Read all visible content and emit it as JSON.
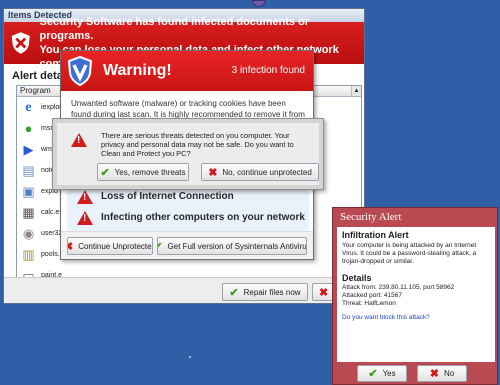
{
  "main_window": {
    "title": "Items Detected",
    "banner_line1": "Security Software has found infected documents or programs.",
    "banner_line2": "You can lose your personal data and infect other network computers.",
    "alert_details_label": "Alert details",
    "list_header": "Program",
    "programs": [
      {
        "label": "iexplor",
        "icon": "internet-explorer-icon"
      },
      {
        "label": "msmn.",
        "icon": "messenger-icon"
      },
      {
        "label": "wmp",
        "icon": "media-player-icon"
      },
      {
        "label": "note",
        "icon": "notepad-icon"
      },
      {
        "label": "explo",
        "icon": "explorer-icon"
      },
      {
        "label": "calc.ex",
        "icon": "calculator-icon"
      },
      {
        "label": "user32",
        "icon": "disc-icon"
      },
      {
        "label": "pools.e",
        "icon": "calendar-icon"
      },
      {
        "label": "paint.e",
        "icon": "printer-icon"
      }
    ],
    "repair_button": "Repair files now",
    "second_button_visible": "Le"
  },
  "warning_dialog": {
    "title": "Warning!",
    "count": "3 infection found",
    "message": "Unwanted software (malware) or tracking cookies have been found during last scan. It is highly recommended to remove it from your computer.",
    "risks": [
      "Loss of Internet Connection",
      "Infecting other computers on your network"
    ],
    "continue_button": "Continue Unprotected",
    "full_version_button": "Get Full version of Sysinternals Antivirus"
  },
  "confirm_dialog": {
    "message": "There are serious threats detected on you computer. Your privacy and personal data may not be safe. Do you want to Clean and Protect you PC?",
    "yes_button": "Yes, remove threats",
    "no_button": "No, continue unprotected"
  },
  "security_alert": {
    "title": "Security Alert",
    "heading": "Infiltration Alert",
    "description": "Your computer is being attacked by an Internet Virus. It could be a password-stealing attack, a trojan-dropped or similar.",
    "details_heading": "Details",
    "attack_from": "Attack from: 239.80.11.105, port 58962",
    "attacked_port": "Attacked port: 41567",
    "threat": "Threat: HalfLemon",
    "question": "Do you want block this attack?",
    "yes_button": "Yes",
    "no_button": "No"
  },
  "colors": {
    "desktop": "#2f5fa6",
    "banner_red": "#c91515",
    "security_alert_frame": "#b94a52",
    "link_blue": "#1a3fd0"
  }
}
